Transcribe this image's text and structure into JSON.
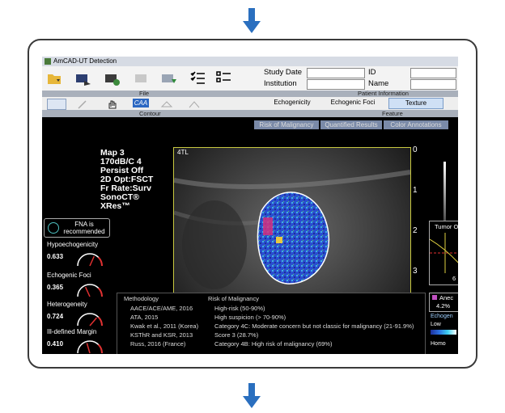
{
  "app": {
    "title": "AmCAD-UT Detection"
  },
  "toolbar": {
    "section_file": "File",
    "section_contour": "Contour",
    "section_patient": "Patient Information",
    "section_feature": "Feature",
    "caa_label": "CAA"
  },
  "study": {
    "study_date_label": "Study Date",
    "institution_label": "Institution",
    "id_label": "ID",
    "name_label": "Name"
  },
  "features": {
    "echogenicity": "Echogenicity",
    "echogenic_foci": "Echogenic Foci",
    "texture": "Texture"
  },
  "tabs": {
    "risk": "Risk of Malignancy",
    "quantified": "Quantified Results",
    "color": "Color Annotations"
  },
  "scanner": {
    "lines": [
      "Map 3",
      "170dB/C 4",
      "Persist Off",
      "2D Opt:FSCT",
      "Fr Rate:Surv",
      "SonoCT®",
      "XRes™"
    ]
  },
  "image": {
    "corner_label": "4TL"
  },
  "depth": {
    "marks": [
      "0",
      "1",
      "2",
      "3"
    ]
  },
  "fna": {
    "label": "FNA is recommended"
  },
  "gauges": [
    {
      "name": "Hypoechogenicity",
      "value": "0.633",
      "level": 0.633
    },
    {
      "name": "Echogenic Foci",
      "value": "0.365",
      "level": 0.365
    },
    {
      "name": "Heterogeneity",
      "value": "0.724",
      "level": 0.724
    },
    {
      "name": "Ill-defined Margin",
      "value": "0.410",
      "level": 0.41
    }
  ],
  "risk": {
    "header_method": "Methodology",
    "header_risk": "Risk of Malignancy",
    "rows": [
      {
        "method": "AACE/ACE/AME, 2016",
        "risk": "High-risk (50-90%)"
      },
      {
        "method": "ATA, 2015",
        "risk": "High suspicion (> 70-90%)"
      },
      {
        "method": "Kwak et al., 2011 (Korea)",
        "risk": "Category 4C: Moderate concern but not classic for malignancy (21-91.9%)"
      },
      {
        "method": "KSThR and KSR, 2013",
        "risk": "Score 3 (28.7%)"
      },
      {
        "method": "Russ, 2016 (France)",
        "risk": "Category 4B: High risk of malignancy (69%)"
      }
    ]
  },
  "tumor": {
    "label": "Tumor O",
    "value": "6"
  },
  "anechoic": {
    "label": "Anec",
    "value": "4.2%"
  },
  "echogenicity_legend": {
    "title": "Echogen",
    "low": "Low",
    "homo": "Homo"
  }
}
